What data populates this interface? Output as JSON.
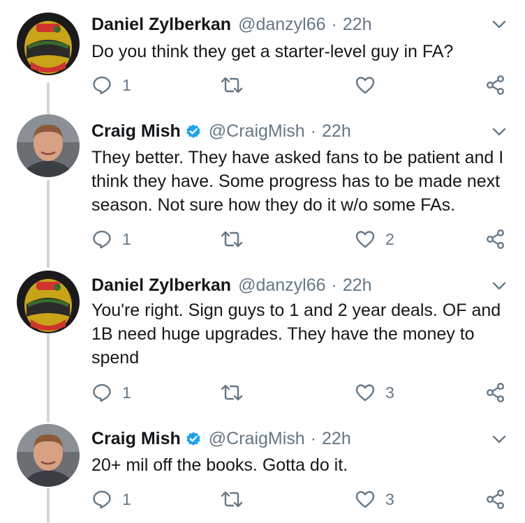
{
  "tweets": [
    {
      "name": "Daniel Zylberkan",
      "verified": false,
      "handle": "@danzyl66",
      "dot": "·",
      "time": "22h",
      "text": "Do you think they get a starter-level guy in FA?",
      "replies": "1",
      "retweets": "",
      "likes": "",
      "avatar": "helmet-avatar"
    },
    {
      "name": "Craig Mish",
      "verified": true,
      "handle": "@CraigMish",
      "dot": "·",
      "time": "22h",
      "text": "They better. They have asked fans to be patient and I think they have. Some progress has to be made next season. Not sure how they do it w/o some FAs.",
      "replies": "1",
      "retweets": "",
      "likes": "2",
      "avatar": "man-avatar"
    },
    {
      "name": "Daniel Zylberkan",
      "verified": false,
      "handle": "@danzyl66",
      "dot": "·",
      "time": "22h",
      "text": "You're right. Sign guys to 1 and 2 year deals.  OF and 1B need huge upgrades. They have the money to spend",
      "replies": "1",
      "retweets": "",
      "likes": "3",
      "avatar": "helmet-avatar"
    },
    {
      "name": "Craig Mish",
      "verified": true,
      "handle": "@CraigMish",
      "dot": "·",
      "time": "22h",
      "text": "20+ mil off the books. Gotta do it.",
      "replies": "1",
      "retweets": "",
      "likes": "3",
      "avatar": "man-avatar"
    }
  ],
  "colors": {
    "text": "#14171a",
    "secondary": "#657786",
    "verified": "#1da1f2",
    "thread_line": "#ccd6dd"
  },
  "icons": [
    "reply-icon",
    "retweet-icon",
    "like-icon",
    "share-icon",
    "chevron-down-icon",
    "verified-badge-icon"
  ]
}
